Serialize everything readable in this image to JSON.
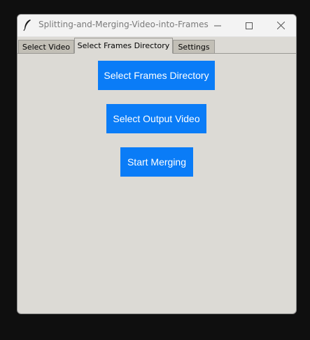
{
  "window": {
    "title": "Splitting-and-Merging-Video-into-Frames",
    "app_icon": "feather-icon",
    "controls": {
      "minimize_icon": "minimize-icon",
      "maximize_icon": "maximize-icon",
      "close_icon": "close-icon"
    }
  },
  "tabs": [
    {
      "label": "Select Video",
      "selected": false
    },
    {
      "label": "Select Frames Directory",
      "selected": true
    },
    {
      "label": "Settings",
      "selected": false
    }
  ],
  "main": {
    "buttons": [
      {
        "label": "Select Frames Directory"
      },
      {
        "label": "Select Output Video"
      },
      {
        "label": "Start Merging"
      }
    ]
  },
  "colors": {
    "accent_button": "#0a7cf7",
    "window_bg": "#dcdad5",
    "tab_inactive": "#c2bfb6"
  }
}
